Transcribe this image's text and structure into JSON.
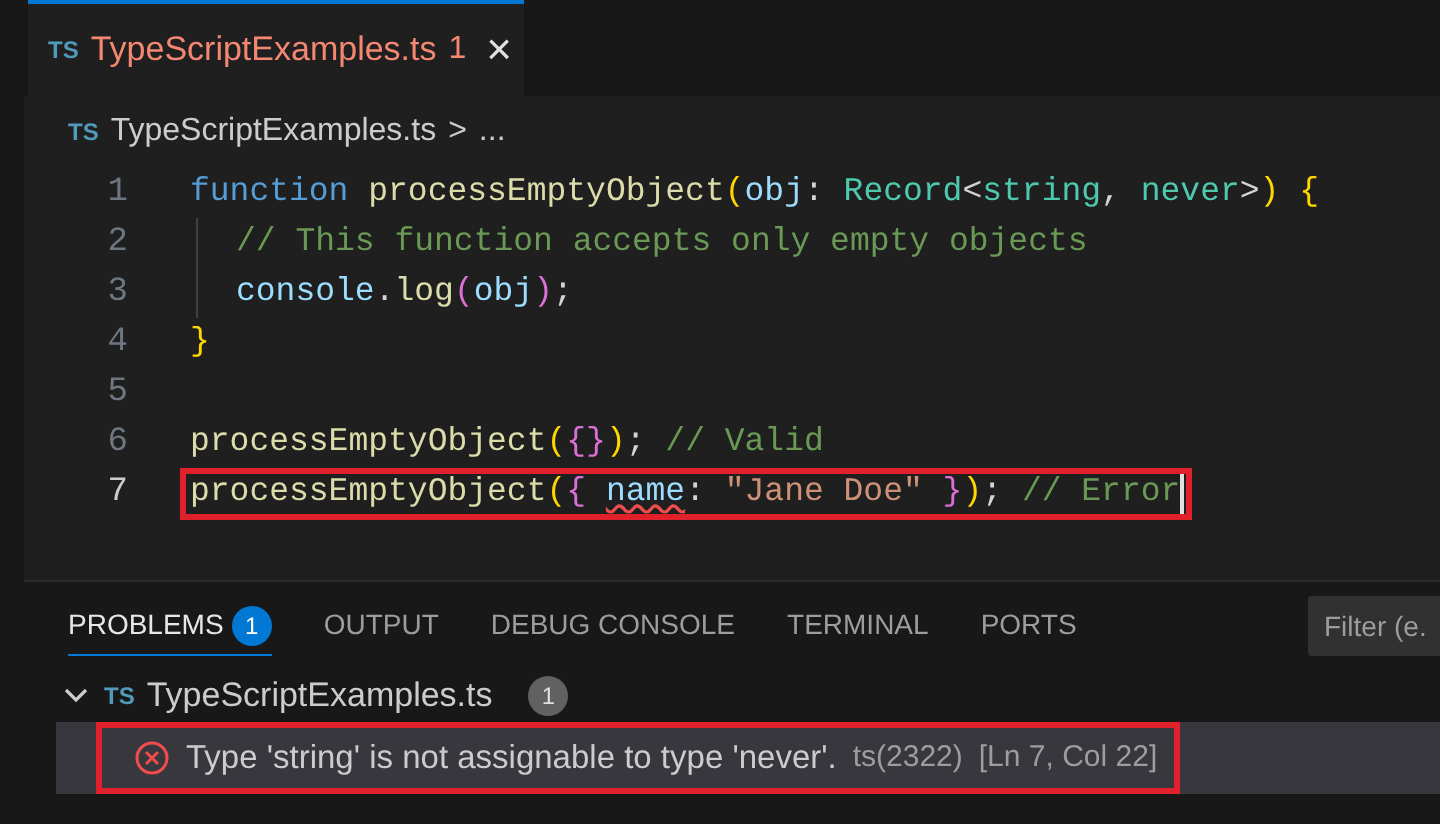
{
  "tabs": [
    {
      "icon_text": "TS",
      "label": "TypeScriptExamples.ts",
      "problems": "1",
      "close": "×",
      "selected": true
    }
  ],
  "breadcrumb": {
    "icon_text": "TS",
    "file": "TypeScriptExamples.ts",
    "separator": ">",
    "rest": "..."
  },
  "code_lines": [
    {
      "number": "1",
      "highlighted": false,
      "tokens": [
        {
          "text": "function ",
          "kind": "keyword"
        },
        {
          "text": "processEmptyObject",
          "kind": "function"
        },
        {
          "text": "(",
          "kind": "bracket1"
        },
        {
          "text": "obj",
          "kind": "param"
        },
        {
          "text": ": ",
          "kind": "plain"
        },
        {
          "text": "Record",
          "kind": "type"
        },
        {
          "text": "<",
          "kind": "plain"
        },
        {
          "text": "string",
          "kind": "type"
        },
        {
          "text": ", ",
          "kind": "plain"
        },
        {
          "text": "never",
          "kind": "type"
        },
        {
          "text": ">",
          "kind": "plain"
        },
        {
          "text": ")",
          "kind": "bracket1"
        },
        {
          "text": " {",
          "kind": "bracket1"
        }
      ]
    },
    {
      "number": "2",
      "highlighted": false,
      "indent": true,
      "tokens": [
        {
          "text": "// This function accepts only empty objects",
          "kind": "comment"
        }
      ]
    },
    {
      "number": "3",
      "highlighted": false,
      "indent": true,
      "tokens": [
        {
          "text": "console",
          "kind": "param"
        },
        {
          "text": ".",
          "kind": "plain"
        },
        {
          "text": "log",
          "kind": "function"
        },
        {
          "text": "(",
          "kind": "bracket2"
        },
        {
          "text": "obj",
          "kind": "param"
        },
        {
          "text": ")",
          "kind": "bracket2"
        },
        {
          "text": ";",
          "kind": "plain"
        }
      ]
    },
    {
      "number": "4",
      "highlighted": false,
      "tokens": [
        {
          "text": "}",
          "kind": "bracket1"
        }
      ]
    },
    {
      "number": "5",
      "highlighted": false
    },
    {
      "number": "6",
      "highlighted": false,
      "tokens": [
        {
          "text": "processEmptyObject",
          "kind": "function"
        },
        {
          "text": "(",
          "kind": "bracket1"
        },
        {
          "text": "{}",
          "kind": "bracket2"
        },
        {
          "text": ")",
          "kind": "bracket1"
        },
        {
          "text": "; ",
          "kind": "plain"
        },
        {
          "text": "// Valid",
          "kind": "comment"
        }
      ]
    },
    {
      "number": "7",
      "highlighted": true,
      "cursor": true,
      "tokens": [
        {
          "text": "processEmptyObject",
          "kind": "function"
        },
        {
          "text": "(",
          "kind": "bracket1"
        },
        {
          "text": "{ ",
          "kind": "bracket2"
        },
        {
          "text": "name",
          "kind": "param",
          "squiggle": true
        },
        {
          "text": ": ",
          "kind": "plain"
        },
        {
          "text": "\"Jane Doe\"",
          "kind": "string"
        },
        {
          "text": " }",
          "kind": "bracket2"
        },
        {
          "text": ")",
          "kind": "bracket1"
        },
        {
          "text": "; ",
          "kind": "plain"
        },
        {
          "text": "// Error",
          "kind": "comment"
        }
      ]
    }
  ],
  "panel": {
    "tabs": [
      {
        "label": "PROBLEMS",
        "badge": "1",
        "selected": true
      },
      {
        "label": "OUTPUT",
        "selected": false
      },
      {
        "label": "DEBUG CONSOLE",
        "selected": false
      },
      {
        "label": "TERMINAL",
        "selected": false
      },
      {
        "label": "PORTS",
        "selected": false
      }
    ],
    "filter": {
      "placeholder": "Filter (e."
    },
    "files": [
      {
        "expanded": true,
        "icon_text": "TS",
        "name": "TypeScriptExamples.ts",
        "count": "1",
        "problems": [
          {
            "kind": "error",
            "highlighted": true,
            "message": "Type 'string' is not assignable to type 'never'.",
            "code": "ts(2322)",
            "location": "[Ln 7, Col 22]"
          }
        ]
      }
    ]
  }
}
